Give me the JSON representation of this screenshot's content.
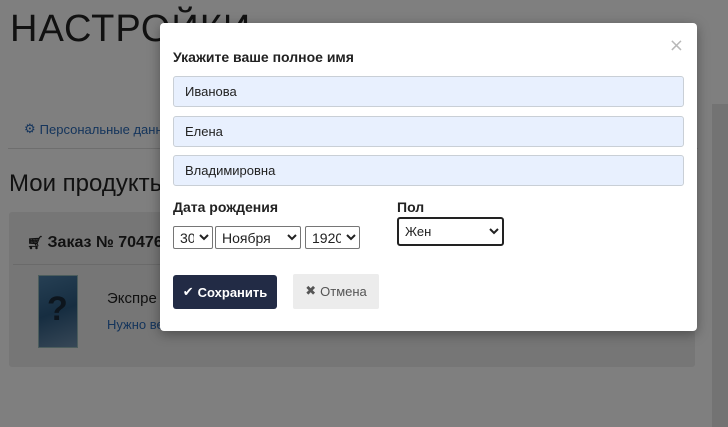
{
  "page": {
    "title": "НАСТРОЙКИ",
    "tab_label": "Персональные данн",
    "products_heading": "Мои продукты",
    "order_title": "Заказ № 70476",
    "product_name": "Экспре",
    "product_link": "Нужно ве"
  },
  "modal": {
    "heading": "Укажите ваше полное имя",
    "close_symbol": "×",
    "last_name": "Иванова",
    "first_name": "Елена",
    "middle_name": "Владимировна",
    "dob_label": "Дата рождения",
    "dob_day": "30",
    "dob_month": "Ноября",
    "dob_year": "1920",
    "gender_label": "Пол",
    "gender_value": "Жен",
    "save_label": "Сохранить",
    "cancel_label": "Отмена"
  },
  "icons": {
    "tab": "gear-icon",
    "order": "cart-icon",
    "save": "check-icon",
    "cancel": "times-icon"
  },
  "colors": {
    "save_button": "#222b45",
    "cancel_button": "#ececec",
    "input_fill": "#e8f0fe",
    "link": "#2a6ab8"
  }
}
